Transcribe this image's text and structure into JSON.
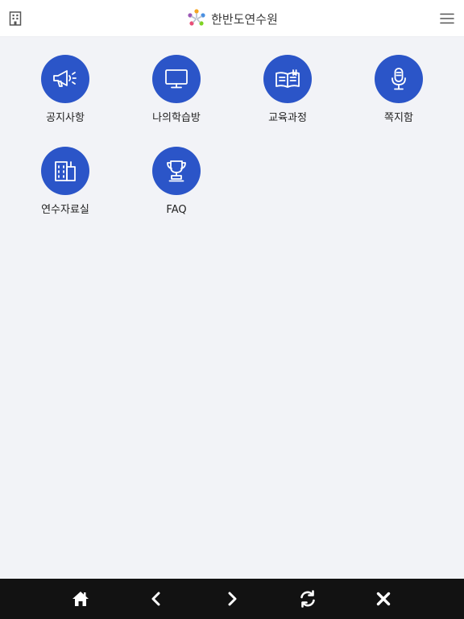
{
  "header": {
    "title": "한반도연수원",
    "left_icon": "building-icon",
    "right_icon": "hamburger-menu-icon",
    "logo_icon": "colorful-people-logo"
  },
  "menu": {
    "items": [
      {
        "label": "공지사항",
        "icon": "megaphone-icon"
      },
      {
        "label": "나의학습방",
        "icon": "monitor-icon"
      },
      {
        "label": "교육과정",
        "icon": "book-icon"
      },
      {
        "label": "쪽지함",
        "icon": "microphone-icon"
      },
      {
        "label": "연수자료실",
        "icon": "building-icon"
      },
      {
        "label": "FAQ",
        "icon": "trophy-icon"
      }
    ]
  },
  "bottom_nav": [
    "home-icon",
    "back-icon",
    "forward-icon",
    "refresh-icon",
    "close-icon"
  ],
  "colors": {
    "accent": "#2b55c8",
    "background": "#f2f3f7",
    "header_bg": "#ffffff",
    "bottom_bar_bg": "#121212"
  }
}
